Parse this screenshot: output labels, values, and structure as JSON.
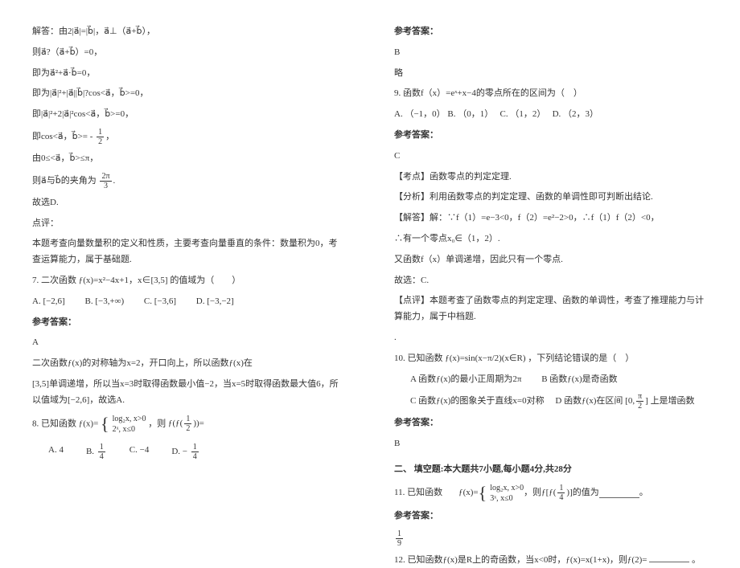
{
  "left": {
    "l1": "解答：由2|a⃗|=|b⃗|，a⃗⊥（a⃗+b⃗），",
    "l2": "则a⃗?（a⃗+b⃗）=0，",
    "l3": "即为a⃗²+a⃗·b⃗=0，",
    "l4": "即为|a⃗|²+|a⃗||b⃗|?cos<a⃗，b⃗>=0，",
    "l5": "即|a⃗|²+2|a⃗|²cos<a⃗，b⃗>=0，",
    "l6_pre": "即cos<a⃗，b⃗>= -",
    "frac1_num": "1",
    "frac1_den": "2",
    "l7": "由0≤<a⃗，b⃗>≤π，",
    "l8_pre": "则a⃗与b⃗的夹角为",
    "frac2_num": "2π",
    "frac2_den": "3",
    "l9": "故选D.",
    "l10": "点评：",
    "l11": "        本题考查向量数量积的定义和性质，主要考查向量垂直的条件：数量积为0，考查运算能力，属于基础题.",
    "q7_pre": "7. 二次函数",
    "q7_expr": "ƒ(x)=x²−4x+1，x∈[3,5]",
    "q7_post": " 的值域为（　　）",
    "q7_opts": {
      "a": "A.  [−2,6]",
      "b": "B.  [−3,+∞)",
      "c": "C.  [−3,6]",
      "d": "D.  [−3,−2]"
    },
    "ans_label": "参考答案：",
    "q7_ans": "A",
    "q7_exp1_pre": "二次函数ƒ(x)的对称轴为x=2，开口向上，所以函数ƒ(x)在",
    "q7_exp2": "[3,5]单调递增，所以当x=3时取得函数最小值−2，当x=5时取得函数最大值6，所以值域为[−2,6]，故选A.",
    "q8_pre": "8. 已知函数",
    "q8_fn": "ƒ(x)=",
    "q8_c1": "log₂x, x>0",
    "q8_c2": "2ˣ, x≤0",
    "q8_mid": "，则",
    "q8_target_pre": "ƒ(ƒ(",
    "q8_inner_num": "1",
    "q8_inner_den": "2",
    "q8_target_post": "))=",
    "q8_opts": {
      "a": "A. 4",
      "b": "B.",
      "c": "C. −4",
      "d": "D. −"
    },
    "q8_b_num": "1",
    "q8_b_den": "4",
    "q8_d_num": "1",
    "q8_d_den": "4"
  },
  "right": {
    "ans_label": "参考答案：",
    "q8_ans": "B",
    "q8_brief": "略",
    "q9": "9. 函数f（x）=eˣ+x−4的零点所在的区间为（　）",
    "q9_opts": {
      "a": "A.  （−1，0）",
      "b": "B.  （0，1）",
      "c": "C.  （1，2）",
      "d": "D.  （2，3）"
    },
    "q9_ans": "C",
    "q9_kp": "【考点】函数零点的判定定理.",
    "q9_an": "【分析】利用函数零点的判定定理、函数的单调性即可判断出结论.",
    "q9_sol1": "【解答】解：∵f（1）=e−3<0，f（2）=e²−2>0，∴f（1）f（2）<0，",
    "q9_sol2": "∴有一个零点x₀∈（1，2）.",
    "q9_sol3": "又函数f（x）单调递增，因此只有一个零点.",
    "q9_sol4": "故选：C.",
    "q9_cmt": "【点评】本题考查了函数零点的判定定理、函数的单调性，考查了推理能力与计算能力，属于中档题.",
    "q10_pre": "10. 已知函数",
    "q10_expr": "ƒ(x)=sin(x−π/2)(x∈R)",
    "q10_post": "，下列结论错误的是（　）",
    "q10_a": "A 函数ƒ(x)的最小正周期为2π",
    "q10_b": "B 函数ƒ(x)是奇函数",
    "q10_c": "C 函数ƒ(x)的图象关于直线x=0对称",
    "q10_d_pre": "D 函数ƒ(x)在区间",
    "q10_d_int_l": "[0,",
    "q10_d_int_num": "π",
    "q10_d_int_den": "2",
    "q10_d_int_r": "]",
    "q10_d_post": "上是增函数",
    "q10_ans": "B",
    "sec2": "二、 填空题:本大题共7小题,每小题4分,共28分",
    "q11_pre": "11. 已知函数",
    "q11_fn": "ƒ(x)=",
    "q11_c1": "log₂x, x>0",
    "q11_c2": "3ˣ, x≤0",
    "q11_mid": "，则ƒ[ƒ(",
    "q11_inner_num": "1",
    "q11_inner_den": "4",
    "q11_post": ")]的值为",
    "q11_ans_num": "1",
    "q11_ans_den": "9",
    "q12_pre": "12. 已知函数ƒ(x)是R上的奇函数，当x<0时，ƒ(x)=x(1+x)，则ƒ(2)=",
    "q12_post": "。"
  }
}
